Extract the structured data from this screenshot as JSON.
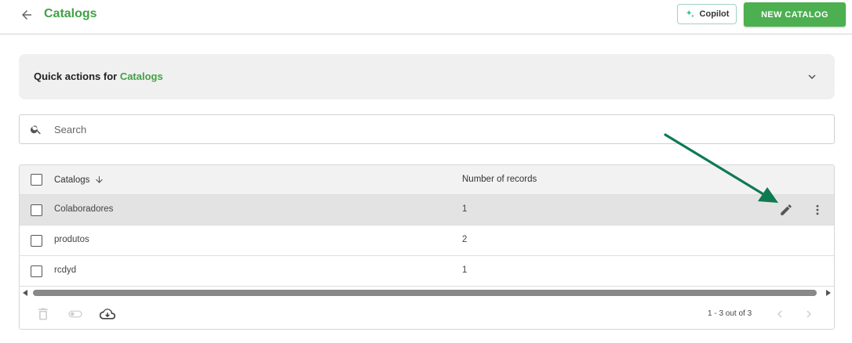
{
  "header": {
    "title": "Catalogs",
    "copilot_label": "Copilot",
    "new_button_label": "NEW CATALOG"
  },
  "quick_actions": {
    "label_prefix": "Quick actions for ",
    "label_accent": "Catalogs"
  },
  "search": {
    "placeholder": "Search",
    "value": ""
  },
  "table": {
    "columns": [
      "Catalogs",
      "Number of records"
    ],
    "rows": [
      {
        "name": "Colaboradores",
        "count": "1"
      },
      {
        "name": "produtos",
        "count": "2"
      },
      {
        "name": "rcdyd",
        "count": "1"
      }
    ]
  },
  "footer": {
    "pagination": "1 - 3 out of 3"
  },
  "colors": {
    "accent": "#43a047",
    "primary_button": "#4caf50",
    "annotation_arrow": "#0f7a52"
  },
  "icons": {
    "back": "arrow-left-icon",
    "copilot": "sparkle-icon",
    "chevron": "chevron-down-icon",
    "search": "search-icon",
    "sort": "arrow-down-icon",
    "edit": "pencil-icon",
    "more": "more-vertical-icon",
    "delete": "trash-icon",
    "toggle": "toggle-icon",
    "download": "cloud-download-icon",
    "prev": "chevron-left-icon",
    "next": "chevron-right-icon"
  }
}
